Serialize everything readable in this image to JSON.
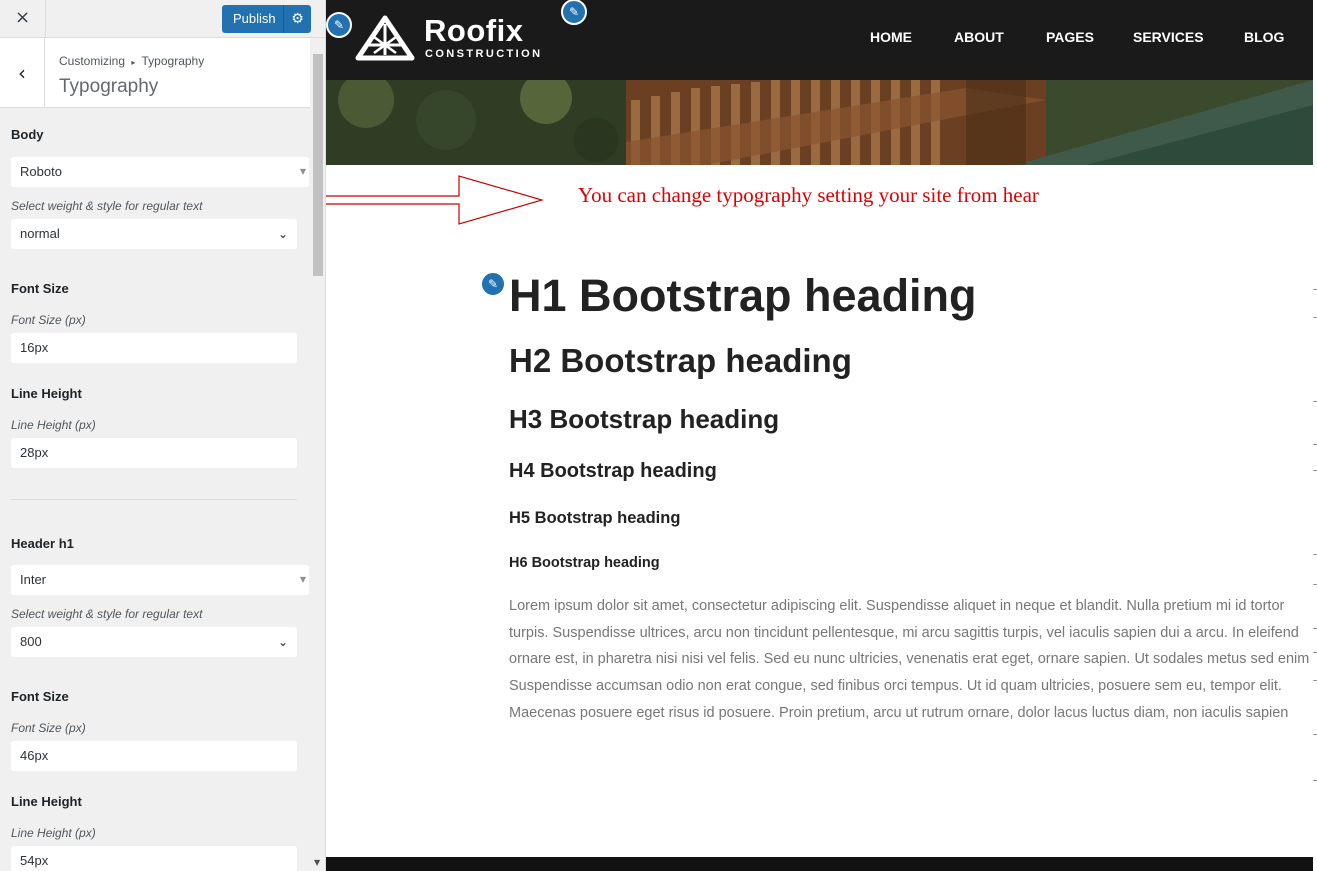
{
  "topbar": {
    "close_icon": "×",
    "publish_label": "Publish",
    "gear_icon": "gear-icon"
  },
  "section": {
    "breadcrumb_root": "Customizing",
    "breadcrumb_sep": "▸",
    "breadcrumb_current": "Typography",
    "title": "Typography"
  },
  "body_controls": {
    "title": "Body",
    "font_family": "Roboto",
    "weight_desc": "Select weight & style for regular text",
    "weight": "normal",
    "font_size_title": "Font Size",
    "font_size_desc": "Font Size (px)",
    "font_size": "16px",
    "line_height_title": "Line Height",
    "line_height_desc": "Line Height (px)",
    "line_height": "28px"
  },
  "h1_controls": {
    "title": "Header h1",
    "font_family": "Inter",
    "weight_desc": "Select weight & style for regular text",
    "weight": "800",
    "font_size_title": "Font Size",
    "font_size_desc": "Font Size (px)",
    "font_size": "46px",
    "line_height_title": "Line Height",
    "line_height_desc": "Line Height (px)",
    "line_height": "54px"
  },
  "site": {
    "logo_word": "Roofix",
    "logo_sub": "CONSTRUCTION",
    "nav": [
      "HOME",
      "ABOUT",
      "PAGES",
      "SERVICES",
      "BLOG"
    ]
  },
  "annotation": "You can change typography setting your site from hear",
  "headings": {
    "h1": "H1 Bootstrap heading",
    "h2": "H2 Bootstrap heading",
    "h3": "H3 Bootstrap heading",
    "h4": "H4 Bootstrap heading",
    "h5": "H5 Bootstrap heading",
    "h6": "H6 Bootstrap heading"
  },
  "lorem_lines": [
    "Lorem ipsum dolor sit amet, consectetur adipiscing elit. Suspendisse aliquet in neque et blandit. Nulla pretium mi id tortor",
    "turpis. Suspendisse ultrices, arcu non tincidunt pellentesque, mi arcu sagittis turpis, vel iaculis sapien dui a arcu. In eleifend",
    "ornare est, in pharetra nisi nisi vel felis. Sed eu nunc ultricies, venenatis erat eget, ornare sapien. Ut sodales metus sed enim",
    "Suspendisse accumsan odio non erat congue, sed finibus orci tempus. Ut id quam ultricies, posuere sem eu, tempor elit.",
    "Maecenas posuere eget risus id posuere. Proin pretium, arcu ut rutrum ornare, dolor lacus luctus diam, non iaculis sapien"
  ],
  "colors": {
    "accent": "#2271b1",
    "annotation": "#e00000",
    "header_bg": "#1a1a1a"
  }
}
